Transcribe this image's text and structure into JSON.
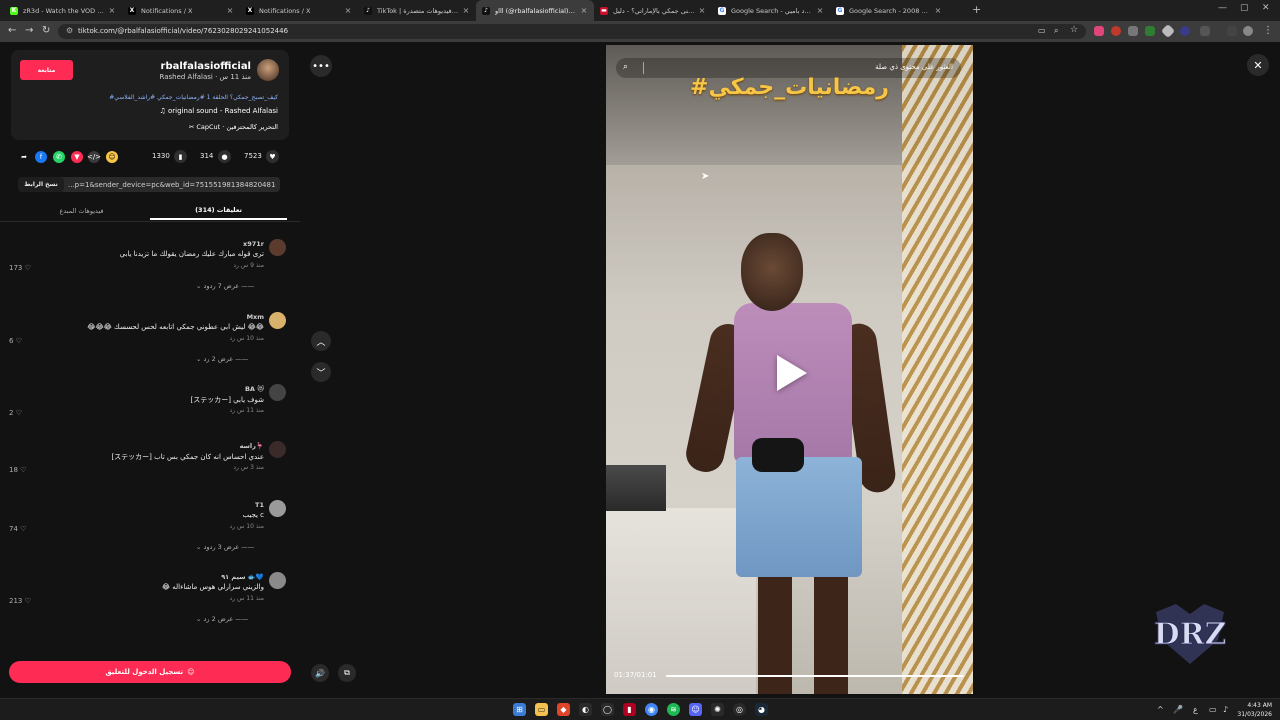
{
  "browser": {
    "tabs": [
      {
        "title": "zR3d - Watch the VOD on Kick",
        "icon": "kick-icon",
        "color": "#53fc18",
        "glyph": "K"
      },
      {
        "title": "Notifications / X",
        "icon": "x-icon",
        "color": "#000000",
        "glyph": "X"
      },
      {
        "title": "Notifications / X",
        "icon": "x-icon",
        "color": "#000000",
        "glyph": "X"
      },
      {
        "title": "TikTok | شاهد فيديوهات متصدرة",
        "icon": "tiktok-icon",
        "color": "#111111",
        "glyph": "♪"
      },
      {
        "title": "اااو (@rbalfalasiofficial) | TikTok",
        "icon": "tiktok-icon",
        "color": "#111111",
        "glyph": "♪"
      },
      {
        "title": "ما معنى جمكي بالإماراتي؟ - دليل",
        "icon": "flag-icon",
        "color": "#c8102e",
        "glyph": "▬"
      },
      {
        "title": "Google Search - حمود باميي",
        "icon": "google-icon",
        "color": "#ffffff",
        "glyph": "G"
      },
      {
        "title": "Google Search - لكزس 2008",
        "icon": "google-icon",
        "color": "#ffffff",
        "glyph": "G"
      }
    ],
    "active_tab": 4,
    "url": "tiktok.com/@rbalfalasiofficial/video/7623028029241052446"
  },
  "profile": {
    "username": "rbalfalasiofficial",
    "subtitle": "Rashed Alfalasi · منذ 11 س",
    "follow_label": "متابعة",
    "hashtags": "#كيف_تصبح_جمكي؟ الحلقة 1 #رمضانيات_جمكي #راشد_الفلاسي",
    "sound": "original sound - Rashed Alfalasi",
    "capcut": "CapCut · التحرير كالمحترفين"
  },
  "stats": {
    "likes": "7523",
    "comments": "314",
    "saves": "1330"
  },
  "share": {
    "copy_label": "نسخ الرابط",
    "link": "...p=1&sender_device=pc&web_id=7515519813848204816"
  },
  "tabs2": {
    "comments": "تعليقات (314)",
    "creator_videos": "فيديوهات المبدع"
  },
  "comments": [
    {
      "user": "x971r",
      "text": "ترى قوله مبارك عليك رمضان يقولك ما تزيدنا يابي",
      "meta": "منذ 9 س    رد",
      "likes": "173",
      "replies": "عرض 7 ردود",
      "avatar_color": "#5b3b2e"
    },
    {
      "user": "Mxm",
      "text": "😂😂😂 ليش ابي عطوني جمكي اتابعه لحس لحسسك 😂😂",
      "meta": "منذ 10 س    رد",
      "likes": "6",
      "replies": "عرض 2 رد",
      "avatar_color": "#d8b26a"
    },
    {
      "user": "BA 😻",
      "text": "[ステッカー] شوف يابي",
      "meta": "منذ 11 س    رد",
      "likes": "2",
      "replies": "",
      "avatar_color": "#444444"
    },
    {
      "user": "راسه🦩",
      "text": "[ステッカー] عندي احساس انه كان جمكي بس تاب",
      "meta": "منذ 3 س    رد",
      "likes": "18",
      "replies": "",
      "avatar_color": "#3a2a2a"
    },
    {
      "user": "T1",
      "text": "يجيب c",
      "meta": "منذ 10 س    رد",
      "likes": "74",
      "replies": "عرض 3 ردود",
      "avatar_color": "#9a9a9a"
    },
    {
      "user": "سيم ٩١ 🐟💙",
      "text": "😂 والزيني سرارلي هوس ماشاءاله",
      "meta": "منذ 11 س    رد",
      "likes": "213",
      "replies": "عرض 2 رد",
      "avatar_color": "#8a8a8a"
    }
  ],
  "login_label": "تسجيل الدخول للتعليق",
  "video": {
    "search_placeholder": "العثور على محتوى ذي صلة",
    "overlay_title": "#رمضانيات_جمكي",
    "time": "01:37/01:01",
    "progress": 1.0
  },
  "taskbar": {
    "time": "4:43 AM",
    "date": "31/03/2026",
    "lang": "ع"
  },
  "colors": {
    "accent": "#fe2c55",
    "overlay_title": "#f7c646",
    "hashtag": "#8fb4ff"
  }
}
